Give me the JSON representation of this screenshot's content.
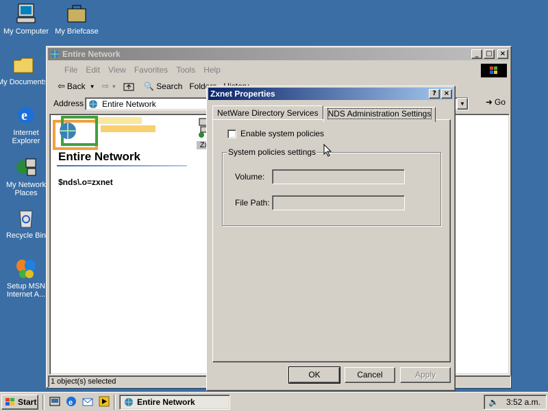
{
  "desktop": {
    "icons": [
      {
        "label": "My Computer"
      },
      {
        "label": "My Briefcase"
      },
      {
        "label": "My Documents"
      },
      {
        "label": "Internet Explorer"
      },
      {
        "label": "My Network Places"
      },
      {
        "label": "Recycle Bin"
      },
      {
        "label": "Setup MSN Internet A..."
      }
    ]
  },
  "explorer": {
    "title": "Entire Network",
    "menu": [
      "File",
      "Edit",
      "View",
      "Favorites",
      "Tools",
      "Help"
    ],
    "toolbar": {
      "back": "Back",
      "search": "Search",
      "folders": "Folders",
      "history": "History"
    },
    "address_label": "Address",
    "address_value": "Entire Network",
    "go": "Go",
    "webpane_title": "Entire Network",
    "webpane_info": "$nds\\.o=zxnet",
    "item_label": "Zx",
    "status": "1 object(s) selected"
  },
  "dialog": {
    "title": "Zxnet Properties",
    "tabs": [
      "NetWare Directory Services",
      "NDS Administration Settings"
    ],
    "checkbox_label": "Enable system policies",
    "group_label": "System policies settings",
    "volume_label": "Volume:",
    "filepath_label": "File Path:",
    "ok": "OK",
    "cancel": "Cancel",
    "apply": "Apply"
  },
  "taskbar": {
    "start": "Start",
    "task": "Entire Network",
    "clock": "3:52 a.m."
  },
  "colors": {
    "desktop": "#3a6ea5",
    "active_title": "#0a246a",
    "face": "#d4d0c8"
  }
}
